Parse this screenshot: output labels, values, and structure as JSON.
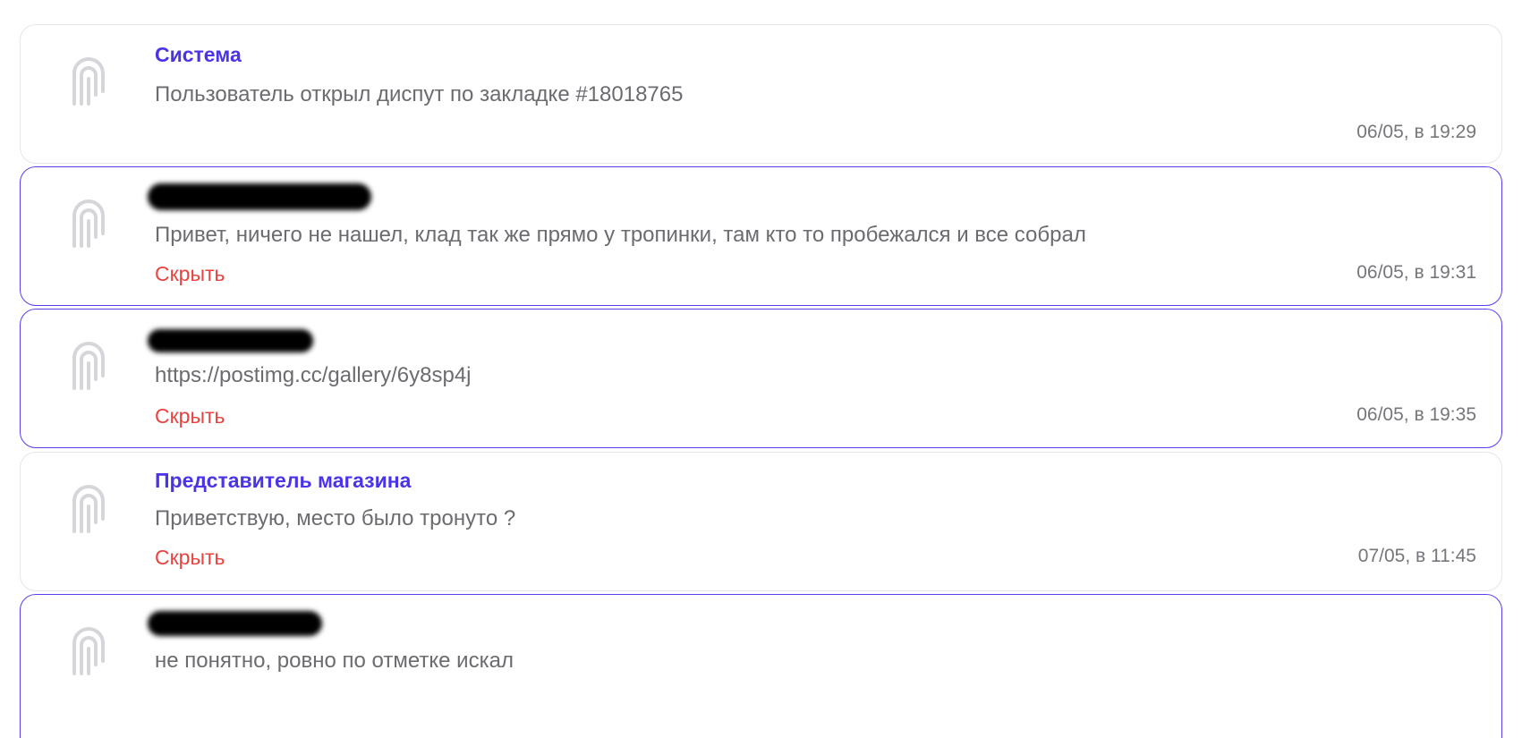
{
  "messages": [
    {
      "author": "Система",
      "author_redacted": false,
      "text": "Пользователь открыл диспут по закладке #18018765",
      "hide_label": "",
      "time": "06/05, в 19:29",
      "highlighted": false
    },
    {
      "author": "",
      "author_redacted": true,
      "text": "Привет, ничего не нашел, клад так же прямо у тропинки, там кто то пробежался и все собрал",
      "hide_label": "Скрыть",
      "time": "06/05, в 19:31",
      "highlighted": true
    },
    {
      "author": "",
      "author_redacted": true,
      "text": "https://postimg.cc/gallery/6y8sp4j",
      "hide_label": "Скрыть",
      "time": "06/05, в 19:35",
      "highlighted": true
    },
    {
      "author": "Представитель магазина",
      "author_redacted": false,
      "text": "Приветствую, место было тронуто ?",
      "hide_label": "Скрыть",
      "time": "07/05, в 11:45",
      "highlighted": false
    },
    {
      "author": "",
      "author_redacted": true,
      "text": "не понятно, ровно по отметке искал",
      "hide_label": "",
      "time": "",
      "highlighted": true
    }
  ],
  "colors": {
    "author_accent": "#4b34e8",
    "hide_link": "#e8433f",
    "highlight_border": "#5a3ff0"
  },
  "icons": {
    "avatar": "system-logo-icon"
  }
}
